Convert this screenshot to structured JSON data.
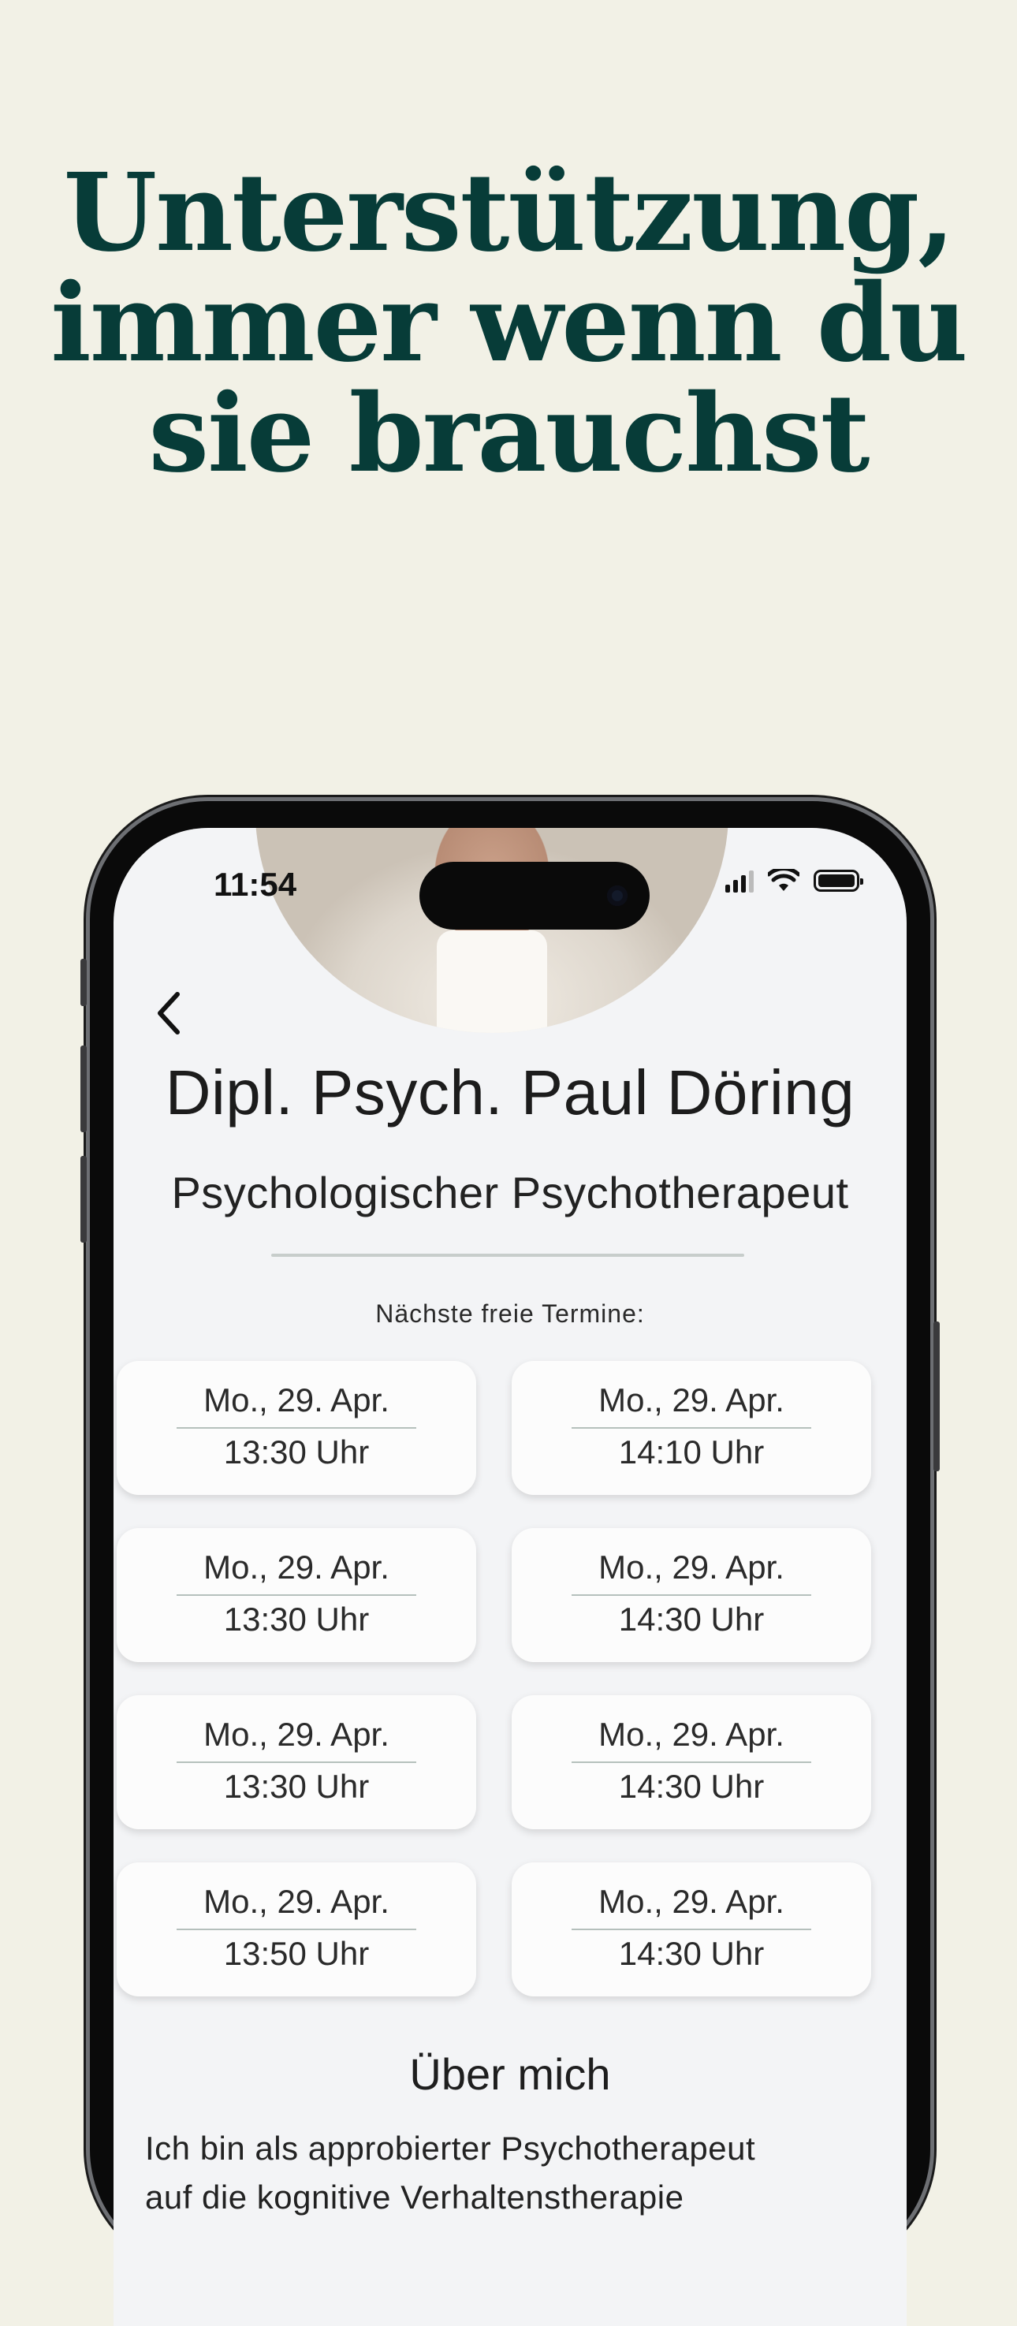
{
  "headline": [
    "Unterstützung,",
    "immer wenn du",
    "sie brauchst"
  ],
  "status_bar": {
    "time": "11:54",
    "icons": [
      "cellular-signal-icon",
      "wifi-icon",
      "battery-icon"
    ]
  },
  "profile": {
    "name": "Dipl. Psych. Paul Döring",
    "role": "Psychologischer Psychotherapeut",
    "photo": "therapist-portrait"
  },
  "appointments": {
    "label": "Nächste freie Termine:",
    "slots": [
      {
        "date": "Mo., 29. Apr.",
        "time": "13:30 Uhr"
      },
      {
        "date": "Mo., 29. Apr.",
        "time": "14:10 Uhr"
      },
      {
        "date": "Mo., 29. Apr.",
        "time": "13:30 Uhr"
      },
      {
        "date": "Mo., 29. Apr.",
        "time": "14:30 Uhr"
      },
      {
        "date": "Mo., 29. Apr.",
        "time": "13:30 Uhr"
      },
      {
        "date": "Mo., 29. Apr.",
        "time": "14:30 Uhr"
      },
      {
        "date": "Mo., 29. Apr.",
        "time": "13:50 Uhr"
      },
      {
        "date": "Mo., 29. Apr.",
        "time": "14:30 Uhr"
      }
    ]
  },
  "about": {
    "title": "Über mich",
    "text_lines": [
      "Ich bin als approbierter Psychotherapeut",
      "auf die kognitive Verhaltenstherapie"
    ]
  },
  "colors": {
    "background": "#f2f1e6",
    "headline": "#073c38",
    "screen": "#f3f4f6"
  }
}
